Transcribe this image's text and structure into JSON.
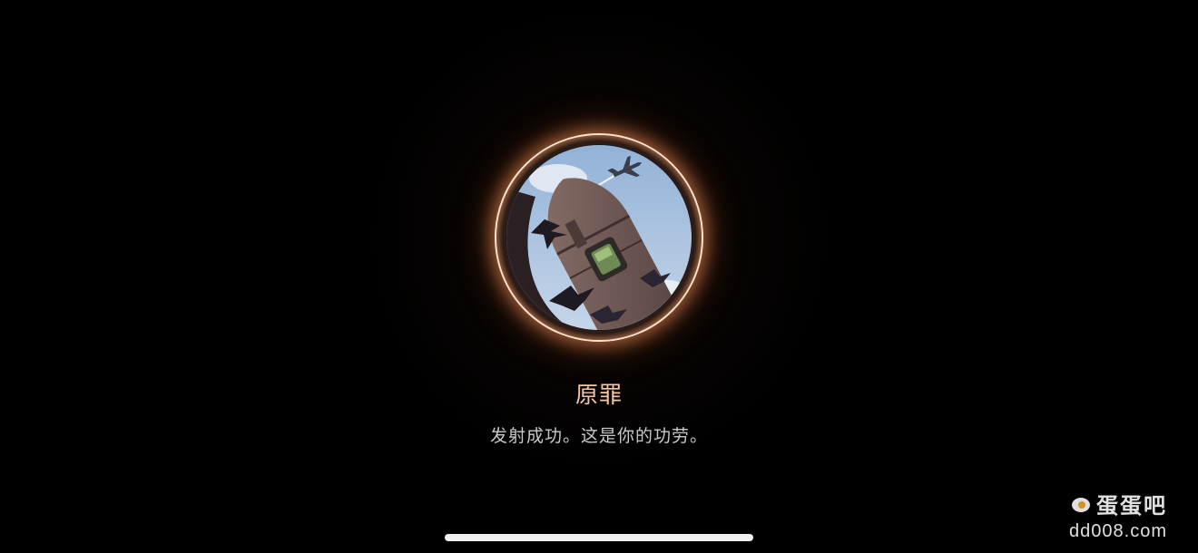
{
  "achievement": {
    "title": "原罪",
    "description": "发射成功。这是你的功劳。",
    "badge_icon": "rocket-launch-badge-icon"
  },
  "colors": {
    "background": "#000000",
    "ring": "#ffe3cc",
    "glow": "#ff9a5a",
    "title": "#f4c7a6",
    "description": "#c9c9c9",
    "sky": "#9fb9d8"
  },
  "watermark": {
    "brand": "蛋蛋吧",
    "url": "dd008.com"
  }
}
